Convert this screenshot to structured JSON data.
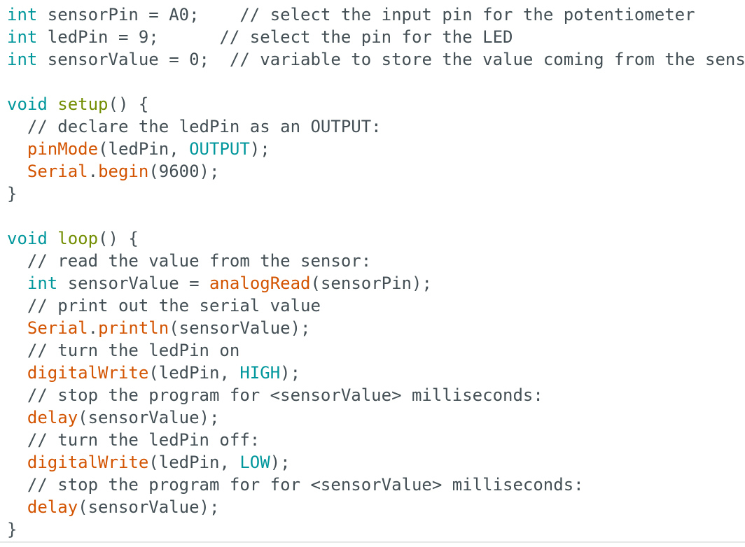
{
  "editor": {
    "lines": [
      [
        {
          "t": "int",
          "c": "type"
        },
        {
          "t": " sensorPin = A0;    ",
          "c": "plain"
        },
        {
          "t": "// select the input pin for the potentiometer",
          "c": "comment"
        }
      ],
      [
        {
          "t": "int",
          "c": "type"
        },
        {
          "t": " ledPin = 9;      ",
          "c": "plain"
        },
        {
          "t": "// select the pin for the LED",
          "c": "comment"
        }
      ],
      [
        {
          "t": "int",
          "c": "type"
        },
        {
          "t": " sensorValue = 0;  ",
          "c": "plain"
        },
        {
          "t": "// variable to store the value coming from the sensor",
          "c": "comment"
        }
      ],
      [],
      [
        {
          "t": "void",
          "c": "type"
        },
        {
          "t": " ",
          "c": "plain"
        },
        {
          "t": "setup",
          "c": "struct"
        },
        {
          "t": "() {",
          "c": "plain"
        }
      ],
      [
        {
          "t": "  // declare the ledPin as an OUTPUT:",
          "c": "comment"
        }
      ],
      [
        {
          "t": "  ",
          "c": "plain"
        },
        {
          "t": "pinMode",
          "c": "func"
        },
        {
          "t": "(ledPin, ",
          "c": "plain"
        },
        {
          "t": "OUTPUT",
          "c": "const"
        },
        {
          "t": ");",
          "c": "plain"
        }
      ],
      [
        {
          "t": "  ",
          "c": "plain"
        },
        {
          "t": "Serial",
          "c": "func"
        },
        {
          "t": ".",
          "c": "plain"
        },
        {
          "t": "begin",
          "c": "func"
        },
        {
          "t": "(9600);",
          "c": "plain"
        }
      ],
      [
        {
          "t": "}",
          "c": "plain"
        }
      ],
      [],
      [
        {
          "t": "void",
          "c": "type"
        },
        {
          "t": " ",
          "c": "plain"
        },
        {
          "t": "loop",
          "c": "struct"
        },
        {
          "t": "() {",
          "c": "plain"
        }
      ],
      [
        {
          "t": "  // read the value from the sensor:",
          "c": "comment"
        }
      ],
      [
        {
          "t": "  ",
          "c": "plain"
        },
        {
          "t": "int",
          "c": "type"
        },
        {
          "t": " sensorValue = ",
          "c": "plain"
        },
        {
          "t": "analogRead",
          "c": "func"
        },
        {
          "t": "(sensorPin);",
          "c": "plain"
        }
      ],
      [
        {
          "t": "  // print out the serial value",
          "c": "comment"
        }
      ],
      [
        {
          "t": "  ",
          "c": "plain"
        },
        {
          "t": "Serial",
          "c": "func"
        },
        {
          "t": ".",
          "c": "plain"
        },
        {
          "t": "println",
          "c": "func"
        },
        {
          "t": "(sensorValue);",
          "c": "plain"
        }
      ],
      [
        {
          "t": "  // turn the ledPin on",
          "c": "comment"
        }
      ],
      [
        {
          "t": "  ",
          "c": "plain"
        },
        {
          "t": "digitalWrite",
          "c": "func"
        },
        {
          "t": "(ledPin, ",
          "c": "plain"
        },
        {
          "t": "HIGH",
          "c": "const"
        },
        {
          "t": ");",
          "c": "plain"
        }
      ],
      [
        {
          "t": "  // stop the program for <sensorValue> milliseconds:",
          "c": "comment"
        }
      ],
      [
        {
          "t": "  ",
          "c": "plain"
        },
        {
          "t": "delay",
          "c": "func"
        },
        {
          "t": "(sensorValue);",
          "c": "plain"
        }
      ],
      [
        {
          "t": "  // turn the ledPin off:",
          "c": "comment"
        }
      ],
      [
        {
          "t": "  ",
          "c": "plain"
        },
        {
          "t": "digitalWrite",
          "c": "func"
        },
        {
          "t": "(ledPin, ",
          "c": "plain"
        },
        {
          "t": "LOW",
          "c": "const"
        },
        {
          "t": ");",
          "c": "plain"
        }
      ],
      [
        {
          "t": "  // stop the program for for <sensorValue> milliseconds:",
          "c": "comment"
        }
      ],
      [
        {
          "t": "  ",
          "c": "plain"
        },
        {
          "t": "delay",
          "c": "func"
        },
        {
          "t": "(sensorValue);",
          "c": "plain"
        }
      ],
      [
        {
          "t": "}",
          "c": "plain"
        }
      ]
    ]
  },
  "colors": {
    "background": "#ffffff",
    "plain_text": "#434f54",
    "keyword_type": "#00979c",
    "function": "#d35400",
    "structure": "#728e00"
  }
}
